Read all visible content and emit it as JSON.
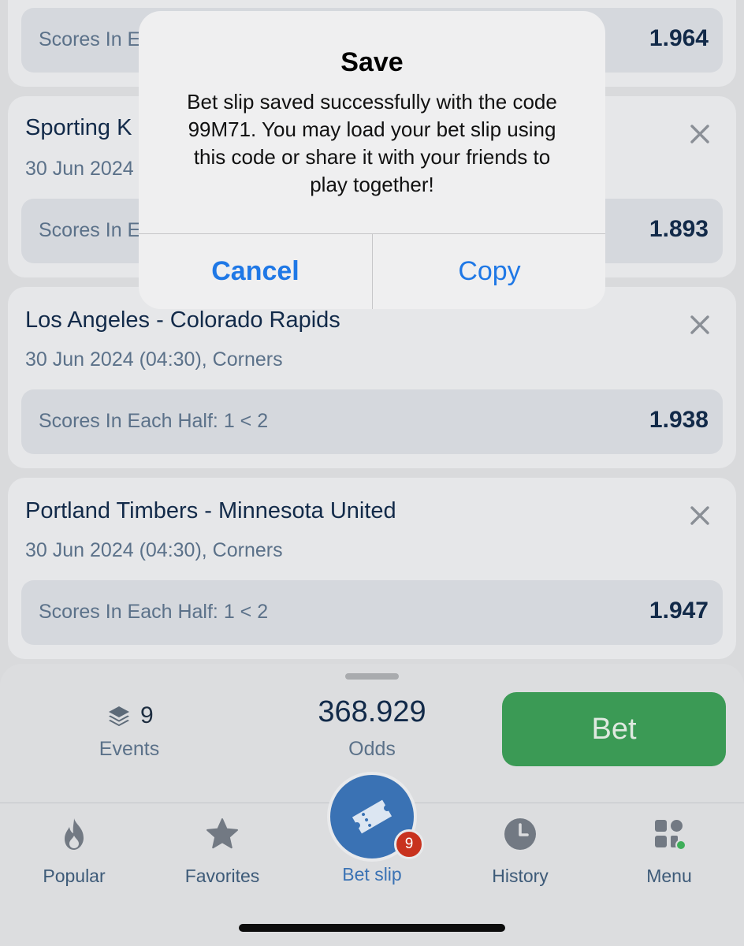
{
  "bets": [
    {
      "match": "",
      "meta": "",
      "market": "Scores In E",
      "odds": "1.964"
    },
    {
      "match": "Sporting K",
      "meta": "30 Jun 2024",
      "market": "Scores In E",
      "odds": "1.893"
    },
    {
      "match": "Los Angeles - Colorado Rapids",
      "meta": "30 Jun 2024 (04:30), Corners",
      "market": "Scores In Each Half: 1 < 2",
      "odds": "1.938"
    },
    {
      "match": "Portland Timbers - Minnesota United",
      "meta": "30 Jun 2024 (04:30), Corners",
      "market": "Scores In Each Half: 1 < 2",
      "odds": "1.947"
    }
  ],
  "summary": {
    "events_count": "9",
    "events_label": "Events",
    "odds_value": "368.929",
    "odds_label": "Odds",
    "bet_button": "Bet"
  },
  "tabbar": {
    "popular": "Popular",
    "favorites": "Favorites",
    "betslip": "Bet slip",
    "betslip_badge": "9",
    "history": "History",
    "menu": "Menu"
  },
  "dialog": {
    "title": "Save",
    "message": "Bet slip saved successfully with the code 99M71. You may load your bet slip using this code or share it with your friends to play together!",
    "cancel": "Cancel",
    "copy": "Copy"
  },
  "colors": {
    "accent_blue": "#3a72b4",
    "bet_green": "#3b9a55",
    "badge_red": "#c8321e",
    "alert_button_blue": "#1f78e6"
  },
  "icons": {
    "close": "close-icon",
    "layers": "layers-icon",
    "popular": "flame-icon",
    "favorites": "star-icon",
    "betslip": "ticket-icon",
    "history": "clock-icon",
    "menu": "grid-icon"
  }
}
